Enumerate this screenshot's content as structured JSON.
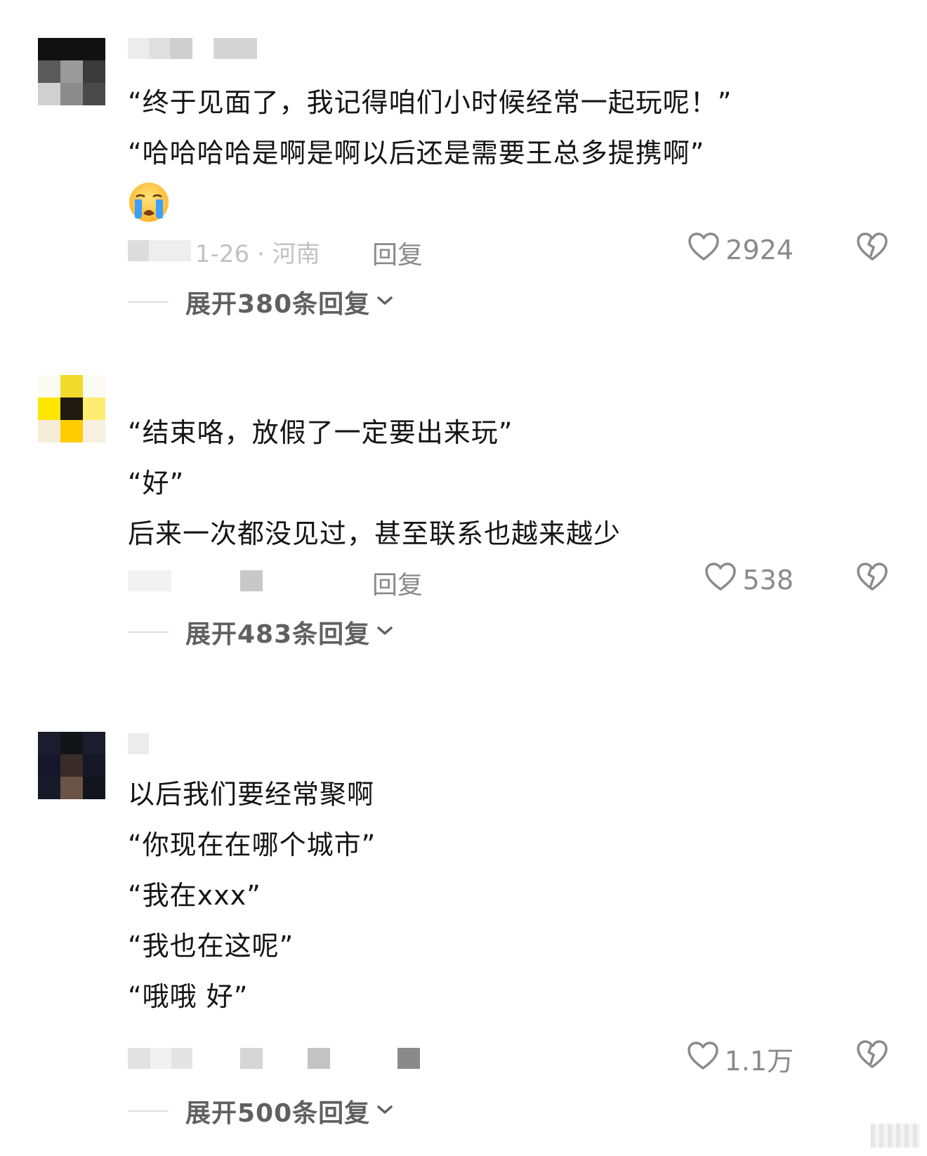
{
  "comments": [
    {
      "lines": [
        "“终于见面了，我记得咱们小时候经常一起玩呢！”",
        "“哈哈哈哈是啊是啊以后还是需要王总多提携啊”"
      ],
      "emoji": "loudly-crying-face",
      "meta_text": "1-26 · 河南",
      "reply_label": "回复",
      "likes": "2924",
      "expand_label": "展开380条回复"
    },
    {
      "lines": [
        "“结束咯，放假了一定要出来玩”",
        "“好”",
        "后来一次都没见过，甚至联系也越来越少"
      ],
      "reply_label": "回复",
      "likes": "538",
      "expand_label": "展开483条回复"
    },
    {
      "lines": [
        "以后我们要经常聚啊",
        "“你现在在哪个城市”",
        "“我在xxx”",
        "“我也在这呢”",
        "“哦哦 好”"
      ],
      "likes": "1.1万",
      "expand_label": "展开500条回复"
    }
  ],
  "icons": {
    "like": "heart-outline-icon",
    "dislike": "broken-heart-icon",
    "expand": "chevron-down-icon"
  },
  "colors": {
    "text": "#141414",
    "muted": "#8a8a8a",
    "expand_text": "#606060"
  }
}
